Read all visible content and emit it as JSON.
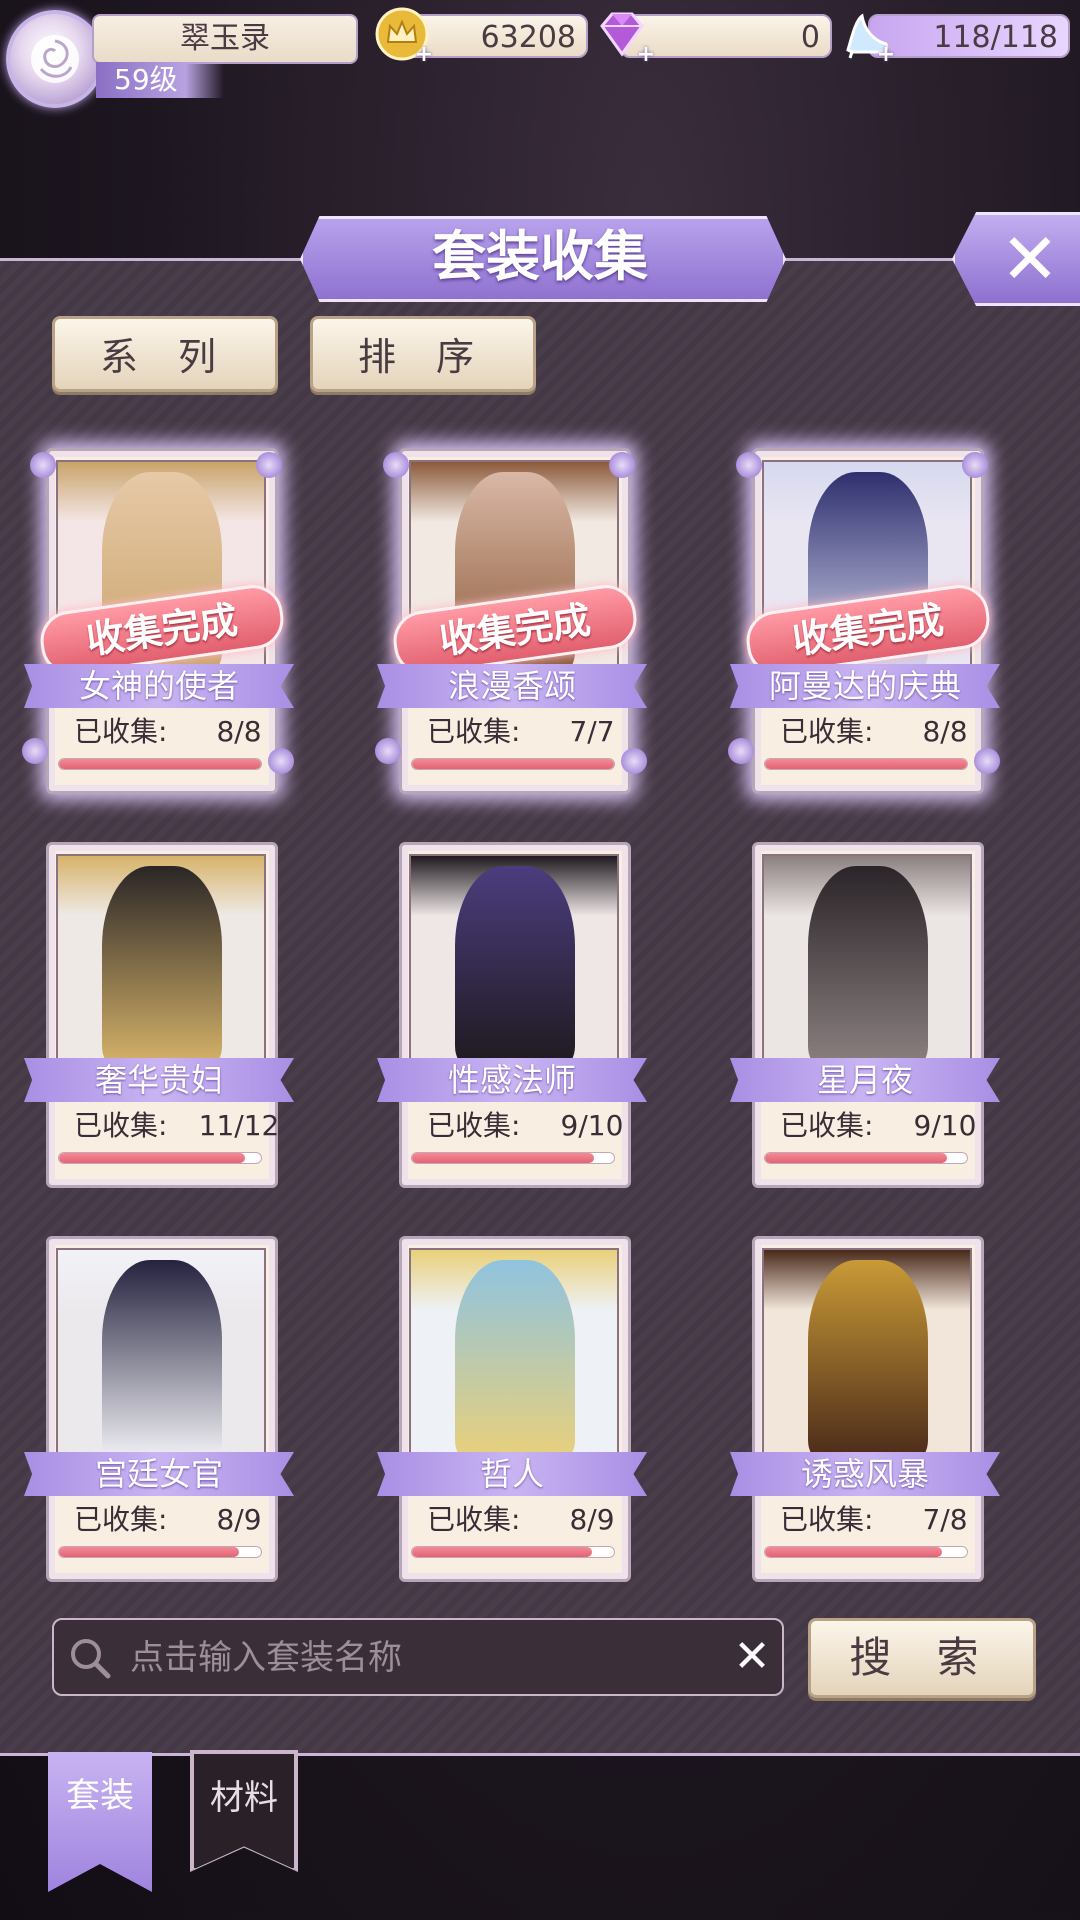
{
  "player": {
    "name": "翠玉录",
    "level": "59级"
  },
  "resources": {
    "gold": "63208",
    "diamonds": "0",
    "stamina": "118/118"
  },
  "panel": {
    "title": "套装收集",
    "filter_series": "系 列",
    "filter_sort": "排 序"
  },
  "complete_stamp": "收集完成",
  "collected_label": "已收集:",
  "suits": [
    {
      "name": "女神的使者",
      "collected": "8/8",
      "progress": 1.0,
      "complete": true
    },
    {
      "name": "浪漫香颂",
      "collected": "7/7",
      "progress": 1.0,
      "complete": true
    },
    {
      "name": "阿曼达的庆典",
      "collected": "8/8",
      "progress": 1.0,
      "complete": true
    },
    {
      "name": "奢华贵妇",
      "collected": "11/12",
      "progress": 0.92,
      "complete": false
    },
    {
      "name": "性感法师",
      "collected": "9/10",
      "progress": 0.9,
      "complete": false
    },
    {
      "name": "星月夜",
      "collected": "9/10",
      "progress": 0.9,
      "complete": false
    },
    {
      "name": "宫廷女官",
      "collected": "8/9",
      "progress": 0.89,
      "complete": false
    },
    {
      "name": "哲人",
      "collected": "8/9",
      "progress": 0.89,
      "complete": false
    },
    {
      "name": "诱惑风暴",
      "collected": "7/8",
      "progress": 0.875,
      "complete": false
    }
  ],
  "search": {
    "placeholder": "点击输入套装名称",
    "button": "搜 索"
  },
  "bottom_tabs": {
    "suits": "套装",
    "materials": "材料"
  },
  "colors": {
    "accent_purple": "#a98fe4",
    "progress_pink": "#e26474",
    "panel_bg": "#4a3d4a"
  }
}
